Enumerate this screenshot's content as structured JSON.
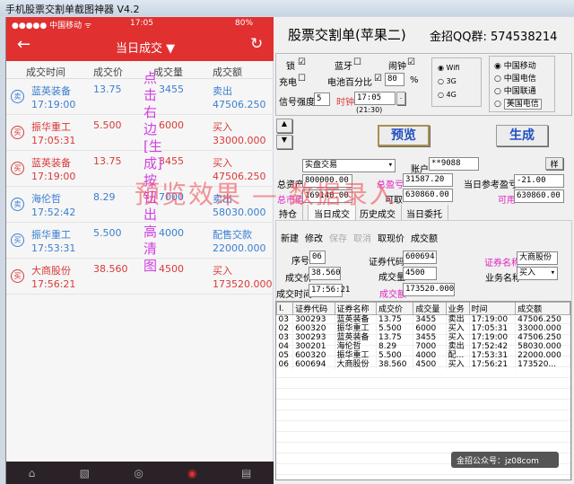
{
  "window_title": "手机股票交割单截图神器 V4.2",
  "phone": {
    "carrier": "●●●●● 中国移动 ᯤ",
    "time": "17:05",
    "battery": "80%",
    "title": "当日成交 ▼",
    "back": "←",
    "refresh": "↻",
    "columns": [
      "成交时间",
      "成交价",
      "成交量",
      "成交额"
    ],
    "rows": [
      {
        "badge": "卖",
        "name": "蓝英装备",
        "time": "17:19:00",
        "price": "13.75",
        "qty": "3455",
        "type": "卖出",
        "amount": "47506.250",
        "color": "blue"
      },
      {
        "badge": "买",
        "name": "振华重工",
        "time": "17:05:31",
        "price": "5.500",
        "qty": "6000",
        "type": "买入",
        "amount": "33000.000",
        "color": "red"
      },
      {
        "badge": "买",
        "name": "蓝英装备",
        "time": "17:19:00",
        "price": "13.75",
        "qty": "3455",
        "type": "买入",
        "amount": "47506.250",
        "color": "red"
      },
      {
        "badge": "卖",
        "name": "海伦哲",
        "time": "17:52:42",
        "price": "8.29",
        "qty": "7000",
        "type": "卖出",
        "amount": "58030.000",
        "color": "blue"
      },
      {
        "badge": "买",
        "name": "振华重工",
        "time": "17:53:31",
        "price": "5.500",
        "qty": "4000",
        "type": "配售交款",
        "amount": "22000.000",
        "color": "blue"
      },
      {
        "badge": "买",
        "name": "大商股份",
        "time": "17:56:21",
        "price": "38.560",
        "qty": "4500",
        "type": "买入",
        "amount": "173520.000",
        "color": "red"
      }
    ],
    "tabbar": [
      "⌂",
      "▧",
      "◎",
      "◉",
      "▤"
    ]
  },
  "right": {
    "title": "股票交割单(苹果二)",
    "qq": "金招QQ群: 574538214",
    "lock": "锁",
    "bluetooth": "蓝牙",
    "alarm": "闹钟",
    "charge": "充电",
    "battery_pct": "电池百分比",
    "battery_val": "80",
    "pct": "%",
    "signal": "信号强度",
    "signal_val": "5",
    "clock": "时钟",
    "clock_val": "17:05",
    "clock_hint": "(21:30)",
    "net": [
      "Wifi",
      "3G",
      "4G"
    ],
    "carriers": [
      "中国移动",
      "中国电信",
      "中国联通",
      "美国电信"
    ],
    "preview": "预览",
    "generate": "生成",
    "mode": "实盘交易",
    "account_lbl": "账户",
    "account": "**9088",
    "sample": "样",
    "total_assets_lbl": "总资产",
    "total_assets": "800000.00",
    "total_pl_lbl": "总盈亏",
    "total_pl": "31587.20",
    "day_pl_lbl": "当日参考盈亏",
    "day_pl": "-21.00",
    "mkt_lbl": "总市值",
    "mkt": "169140.00",
    "withdraw_lbl": "可取",
    "withdraw": "630860.00",
    "avail_lbl": "可用",
    "avail": "630860.00",
    "tabs": [
      "持仓",
      "当日成交",
      "历史成交",
      "当日委托"
    ],
    "toolbar": [
      "新建",
      "修改",
      "保存",
      "取消",
      "取现价",
      "成交额"
    ],
    "seq_lbl": "序号",
    "seq": "06",
    "code_lbl": "证券代码",
    "code": "600694",
    "name_lbl": "证券名称",
    "name": "大商股份",
    "price_lbl": "成交价",
    "price": "38.560",
    "qty_lbl": "成交量",
    "qty": "4500",
    "biz_lbl": "业务名称",
    "biz": "买入",
    "time_lbl": "成交时间",
    "time": "17:56:21",
    "amt_lbl": "成交额",
    "amt": "173520.000",
    "grid_cols": [
      "I.",
      "证券代码",
      "证券名称",
      "成交价",
      "成交量",
      "业务",
      "时间",
      "成交额"
    ],
    "grid_rows": [
      [
        "03",
        "300293",
        "蓝英装备",
        "13.75",
        "3455",
        "卖出",
        "17:19:00",
        "47506.250"
      ],
      [
        "02",
        "600320",
        "振华重工",
        "5.500",
        "6000",
        "买入",
        "17:05:31",
        "33000.000"
      ],
      [
        "03",
        "300293",
        "蓝英装备",
        "13.75",
        "3455",
        "买入",
        "17:19:00",
        "47506.250"
      ],
      [
        "04",
        "300201",
        "海伦哲",
        "8.29",
        "7000",
        "卖出",
        "17:52:42",
        "58030.000"
      ],
      [
        "05",
        "600320",
        "振华重工",
        "5.500",
        "4000",
        "配...",
        "17:53:31",
        "22000.000"
      ],
      [
        "06",
        "600694",
        "大商股份",
        "38.560",
        "4500",
        "买入",
        "17:56:21",
        "173520..."
      ]
    ],
    "wechat": "金招公众号：jz08com"
  },
  "overlay": {
    "vertical": "点击右边[生成]按钮出高清图",
    "banner": "预览效果 — 数据录入"
  }
}
